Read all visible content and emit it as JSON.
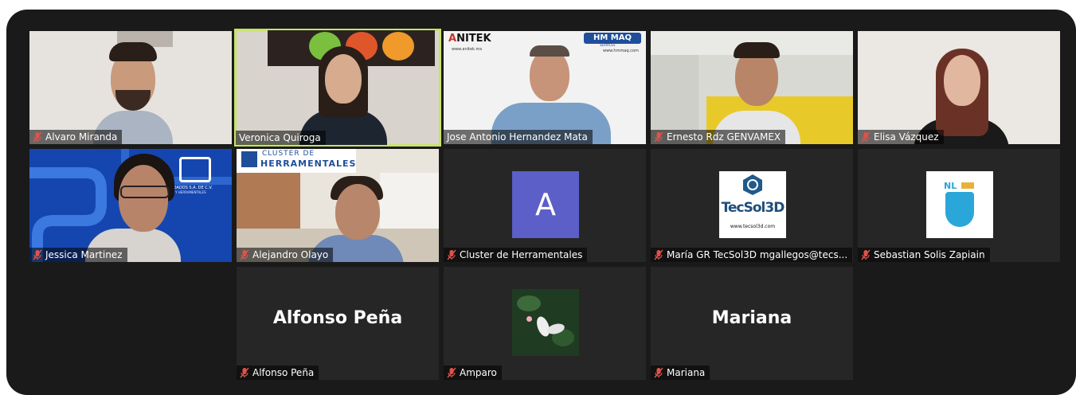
{
  "participants": [
    {
      "name": "Alvaro Miranda"
    },
    {
      "name": "Veronica Quiroga"
    },
    {
      "name": "Jose Antonio Hernandez Mata"
    },
    {
      "name": "Ernesto Rdz GENVAMEX"
    },
    {
      "name": "Elisa Vázquez"
    },
    {
      "name": "Jessica Martinez"
    },
    {
      "name": "Alejandro Olayo"
    },
    {
      "name": "Cluster de Herramentales",
      "avatar_letter": "A"
    },
    {
      "name": "María GR TecSol3D mgallegos@tecs..."
    },
    {
      "name": "Sebastian Solis Zapiain"
    },
    {
      "name": "Alfonso Peña",
      "display_name": "Alfonso Peña"
    },
    {
      "name": "Amparo"
    },
    {
      "name": "Mariana",
      "display_name": "Mariana"
    }
  ],
  "backgrounds": {
    "jose_left_logo": "NITEK",
    "jose_left_url": "www.anitek.mx",
    "jose_right_logo": "HM MAQ",
    "jose_right_sub": "SERVICES",
    "jose_right_url": "www.hmmaq.com",
    "alejandro_banner_line1": "CLUSTER DE",
    "alejandro_banner_line2": "HERRAMENTALES",
    "jessica_company": "CANDADOS S.A. DE C.V.",
    "jessica_company_sub": "... Y HERRAMENTALES"
  },
  "logos": {
    "tecsol_name": "TecSol3D",
    "tecsol_url": "www.tecsol3d.com",
    "nl_text": "NL"
  },
  "colors": {
    "active_speaker_border": "#c7e36a",
    "muted_icon": "#e0524a",
    "avatar_bg": "#5b5fc7"
  }
}
